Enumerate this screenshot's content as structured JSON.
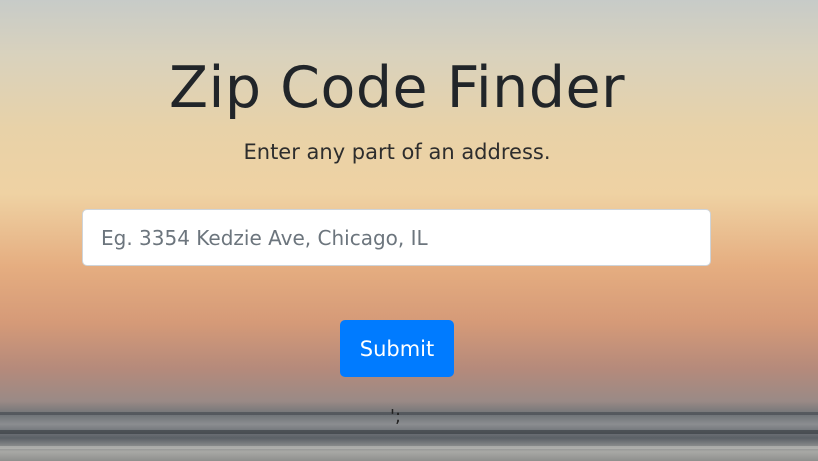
{
  "header": {
    "title": "Zip Code Finder",
    "subtitle": "Enter any part of an address."
  },
  "search": {
    "value": "",
    "placeholder": "Eg. 3354 Kedzie Ave, Chicago, IL"
  },
  "form": {
    "submit_label": "Submit"
  },
  "footer": {
    "stray_text": "';"
  },
  "colors": {
    "accent": "#007bff",
    "text": "#212529"
  }
}
